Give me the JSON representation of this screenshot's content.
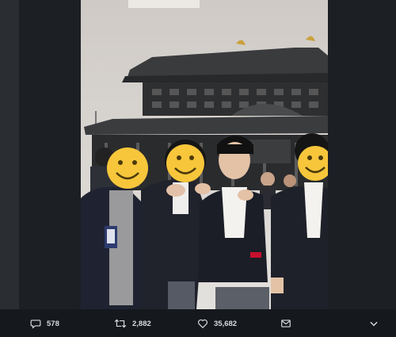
{
  "tweet": {
    "stats": {
      "replies": "578",
      "retweets": "2,882",
      "likes": "35,682"
    }
  },
  "icons": {
    "reply": "comment-bubble-icon",
    "retweet": "retweet-arrows-icon",
    "like": "heart-icon",
    "dm": "envelope-icon",
    "more": "chevron-down-icon"
  },
  "colors": {
    "background": "#1c1f23",
    "action_bar": "#15181c",
    "icon": "#d9dbde",
    "smiley": "#f7c63b"
  }
}
